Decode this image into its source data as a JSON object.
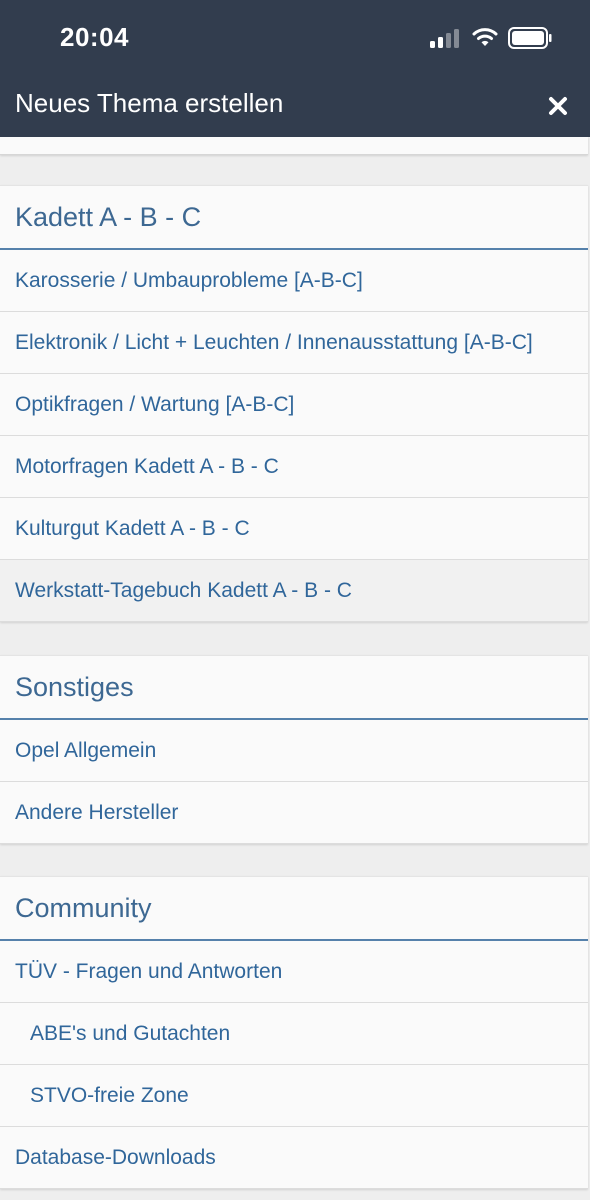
{
  "status_bar": {
    "time": "20:04"
  },
  "header": {
    "title": "Neues Thema erstellen",
    "close_icon": "close-icon"
  },
  "colors": {
    "header_bg": "#323d4e",
    "section_title": "#3d6892",
    "link": "#30669a",
    "divider_accent": "#5581ab"
  },
  "sections": [
    {
      "title": "Kadett A - B - C",
      "items": [
        {
          "label": "Karosserie / Umbauprobleme [A-B-C]"
        },
        {
          "label": "Elektronik / Licht + Leuchten / Innenausstattung [A-B-C]"
        },
        {
          "label": "Optikfragen / Wartung [A-B-C]"
        },
        {
          "label": "Motorfragen Kadett A - B - C"
        },
        {
          "label": "Kulturgut Kadett A - B - C"
        },
        {
          "label": "Werkstatt-Tagebuch Kadett A - B - C"
        }
      ]
    },
    {
      "title": "Sonstiges",
      "items": [
        {
          "label": "Opel Allgemein"
        },
        {
          "label": "Andere Hersteller"
        }
      ]
    },
    {
      "title": "Community",
      "items": [
        {
          "label": "TÜV - Fragen und Antworten"
        },
        {
          "label": "ABE's und Gutachten"
        },
        {
          "label": "STVO-freie Zone"
        },
        {
          "label": "Database-Downloads"
        }
      ]
    }
  ]
}
